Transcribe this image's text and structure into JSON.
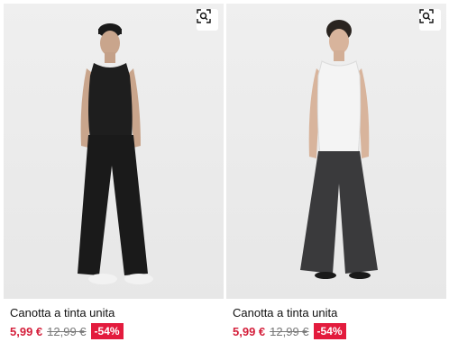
{
  "products": [
    {
      "name": "Canotta a tinta unita",
      "price": "5,99 €",
      "original_price": "12,99 €",
      "discount": "-54%",
      "image_icon": "visual-search-icon",
      "tank_color": "#1e1e1e",
      "pants_color": "#1a1a1a"
    },
    {
      "name": "Canotta a tinta unita",
      "price": "5,99 €",
      "original_price": "12,99 €",
      "discount": "-54%",
      "image_icon": "visual-search-icon",
      "tank_color": "#f4f4f4",
      "pants_color": "#3a3a3c"
    }
  ],
  "colors": {
    "sale_price": "#d41e3a",
    "discount_badge": "#e31b3d",
    "photo_bg": "#ececec"
  }
}
